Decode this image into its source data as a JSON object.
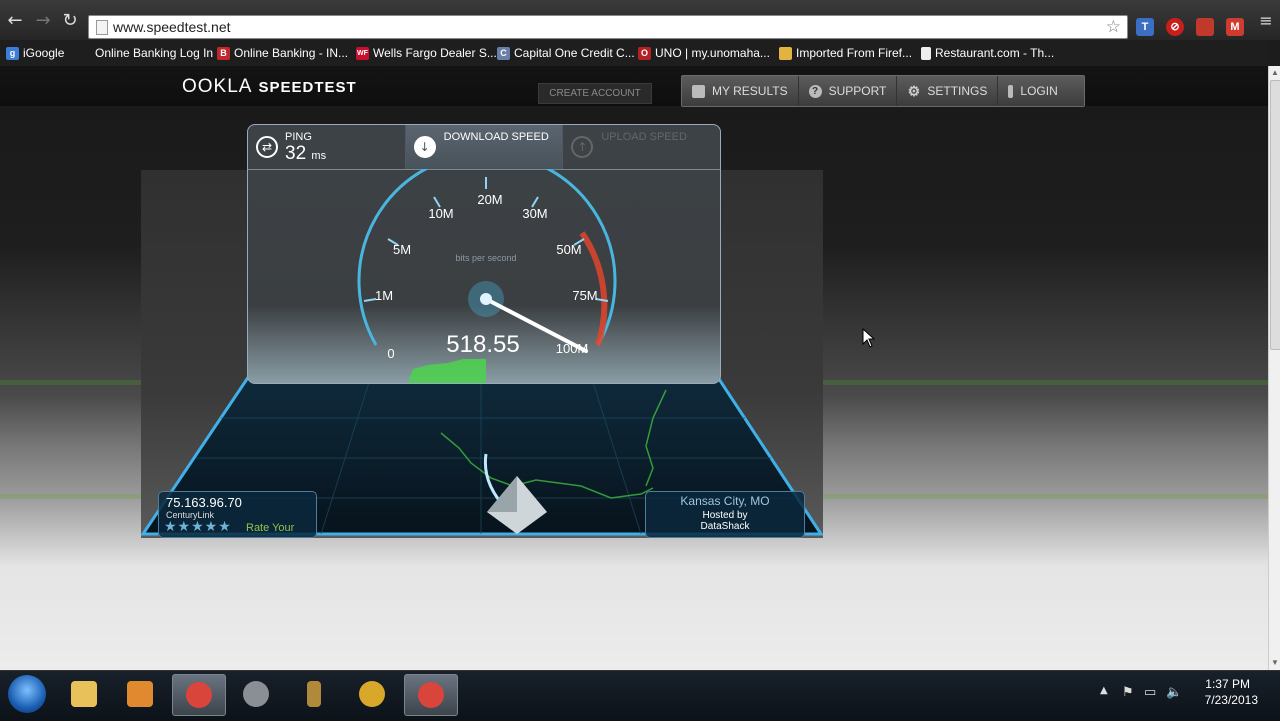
{
  "browser": {
    "url": "www.speedtest.net",
    "bookmarks": [
      {
        "label": "iGoogle",
        "icon": "google-icon",
        "color": "#3b7dd8",
        "glyph": "g"
      },
      {
        "label": "Online Banking Log In",
        "icon": "blank-icon",
        "color": "#1e1e1e",
        "glyph": ""
      },
      {
        "label": "Online Banking - IN...",
        "icon": "bank-icon",
        "color": "#c0282d",
        "glyph": "B"
      },
      {
        "label": "Wells Fargo Dealer S...",
        "icon": "wells-fargo-icon",
        "color": "#c8102e",
        "glyph": "WF"
      },
      {
        "label": "Capital One Credit C...",
        "icon": "capital-one-icon",
        "color": "#6a7fa8",
        "glyph": "C"
      },
      {
        "label": "UNO | my.unomaha...",
        "icon": "uno-icon",
        "color": "#b22222",
        "glyph": "O"
      },
      {
        "label": "Imported From Firef...",
        "icon": "folder-icon",
        "color": "#e3b341",
        "glyph": ""
      },
      {
        "label": "Restaurant.com - Th...",
        "icon": "page-icon",
        "color": "#eeeeee",
        "glyph": ""
      }
    ]
  },
  "site": {
    "logo_main": "OOKLA",
    "logo_sub": "SPEEDTEST",
    "create_account": "CREATE ACCOUNT",
    "menu": [
      {
        "label": "MY RESULTS",
        "icon": "folder-icon",
        "glyph": "▬"
      },
      {
        "label": "SUPPORT",
        "icon": "question-icon",
        "glyph": "?"
      },
      {
        "label": "SETTINGS",
        "icon": "gear-icon",
        "glyph": "⚙"
      },
      {
        "label": "LOGIN",
        "icon": "person-icon",
        "glyph": "i"
      }
    ]
  },
  "speedtest": {
    "ping_label": "PING",
    "ping_value": "32",
    "ping_unit": "ms",
    "download_label": "DOWNLOAD SPEED",
    "upload_label": "UPLOAD SPEED",
    "speed_value": "518.55",
    "unit_caption": "bits per second",
    "gauge_labels": [
      "0",
      "1M",
      "5M",
      "10M",
      "20M",
      "30M",
      "50M",
      "75M",
      "100M"
    ],
    "ip": "75.163.96.70",
    "isp": "CenturyLink",
    "rate_label": "Rate Your",
    "stars": "★★★★★",
    "server_city": "Kansas City, MO",
    "hosted_by": "Hosted by",
    "host": "DataShack",
    "colors": {
      "gauge": "#49b6e0",
      "redline": "#e2452b",
      "accent_green": "#8ec64a"
    }
  },
  "taskbar": {
    "apps": [
      {
        "name": "file-explorer-icon",
        "color": "#e8c15a",
        "active": false
      },
      {
        "name": "media-player-icon",
        "color": "#e0892e",
        "active": false
      },
      {
        "name": "chrome-icon",
        "color": "#d9453a",
        "active": true
      },
      {
        "name": "steam-icon",
        "color": "#8a8f96",
        "active": false
      },
      {
        "name": "game-character-icon",
        "color": "#b08a3a",
        "active": false
      },
      {
        "name": "world-of-warcraft-icon",
        "color": "#d8a82a",
        "active": false
      },
      {
        "name": "chrome-icon",
        "color": "#d9453a",
        "active": true
      }
    ],
    "time": "1:37 PM",
    "date": "7/23/2013"
  }
}
